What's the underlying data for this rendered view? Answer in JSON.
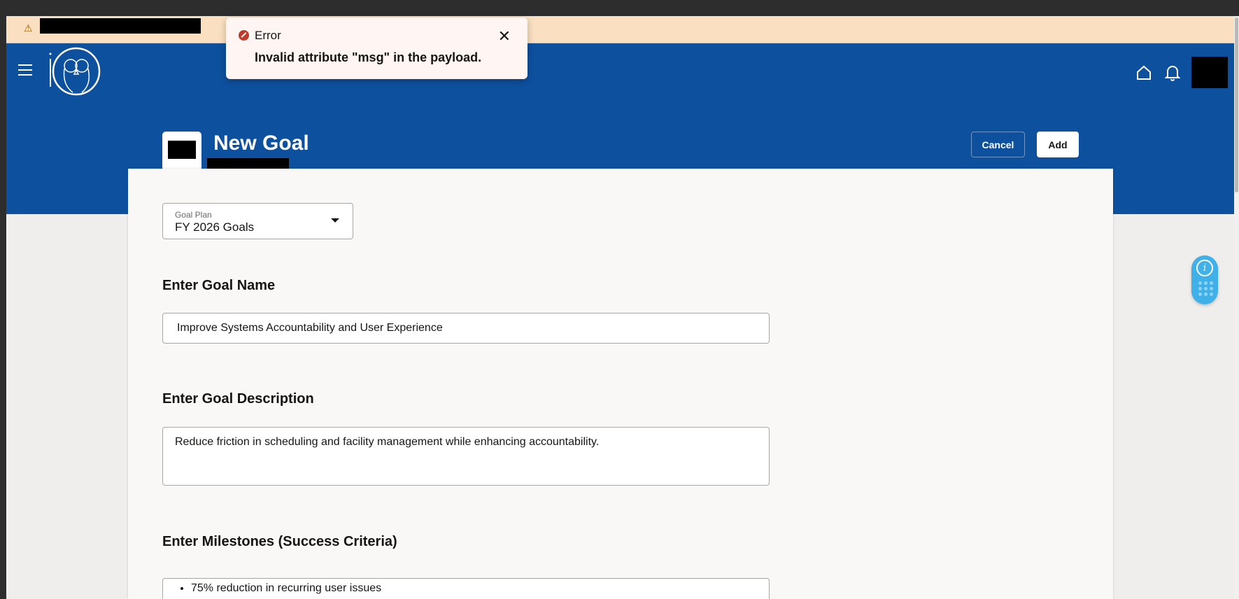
{
  "toast": {
    "title": "Error",
    "message": "Invalid attribute \"msg\" in the payload.",
    "close_icon": "close-icon"
  },
  "header": {
    "title": "New Goal",
    "cancel_label": "Cancel",
    "add_label": "Add"
  },
  "form": {
    "goal_plan": {
      "label": "Goal Plan",
      "value": "FY 2026 Goals"
    },
    "goal_name": {
      "heading": "Enter Goal Name",
      "value": "Improve Systems Accountability and User Experience"
    },
    "goal_description": {
      "heading": "Enter Goal Description",
      "value": "Reduce friction in scheduling and facility management while enhancing accountability."
    },
    "milestones": {
      "heading": "Enter Milestones (Success Criteria)",
      "items": [
        "75% reduction in recurring user issues"
      ]
    }
  },
  "colors": {
    "header": "#0d509e",
    "banner": "#fadfc0",
    "error": "#c0392b",
    "widget": "#3fb1e8"
  }
}
